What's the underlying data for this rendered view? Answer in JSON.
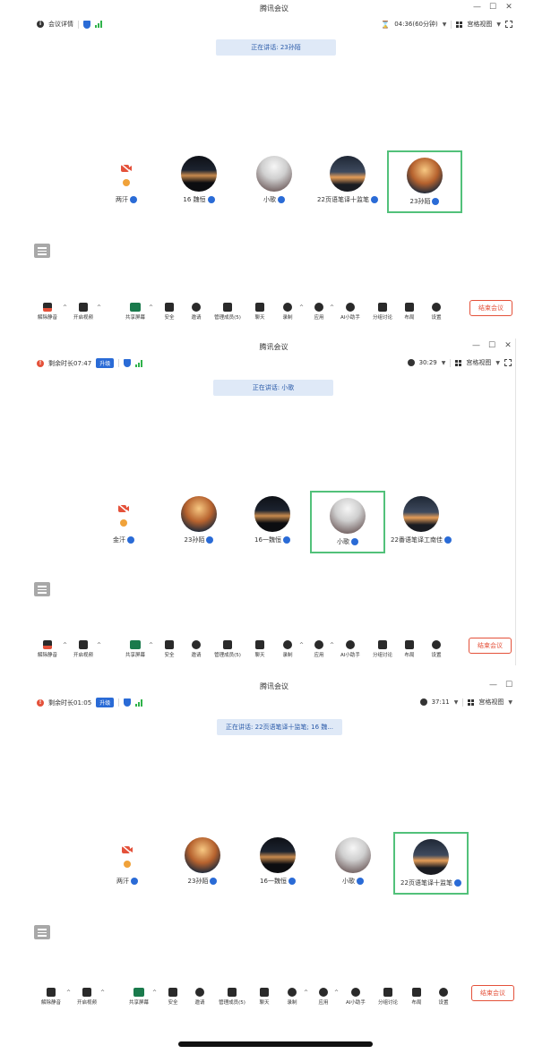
{
  "windows": [
    {
      "title": "腾讯会议",
      "status_left_text": "会议详情",
      "status_left_kind": "info",
      "upgrade_label": "",
      "timer": "04:36(60分钟)",
      "view_label": "宫格视图",
      "speaking": "正在讲话: 23孙陌",
      "participants": [
        {
          "name": "两汗",
          "avatar": "none",
          "active": false
        },
        {
          "name": "16  魏恒",
          "avatar": "e",
          "active": false
        },
        {
          "name": "小歌",
          "avatar": "c",
          "active": false
        },
        {
          "name": "22页语笔译十监笔",
          "avatar": "d",
          "active": false
        },
        {
          "name": "23孙陌",
          "avatar": "a",
          "active": true
        }
      ]
    },
    {
      "title": "腾讯会议",
      "status_left_text": "剩余时长07:47",
      "status_left_kind": "red",
      "upgrade_label": "升级",
      "timer": "30:29",
      "view_label": "宫格视图",
      "speaking": "正在讲话: 小歌",
      "participants": [
        {
          "name": "金汗",
          "avatar": "none",
          "active": false
        },
        {
          "name": "23孙陌",
          "avatar": "a",
          "active": false
        },
        {
          "name": "16一魏恒",
          "avatar": "e",
          "active": false
        },
        {
          "name": "小歌",
          "avatar": "c",
          "active": true
        },
        {
          "name": "22番语笔译工南佳",
          "avatar": "d",
          "active": false
        }
      ]
    },
    {
      "title": "腾讯会议",
      "status_left_text": "剩余时长01:05",
      "status_left_kind": "red",
      "upgrade_label": "升级",
      "timer": "37:11",
      "view_label": "宫格视图",
      "speaking": "正在讲话: 22页语笔译十监笔; 16 魏...",
      "participants": [
        {
          "name": "两汗",
          "avatar": "none",
          "active": false
        },
        {
          "name": "23孙陌",
          "avatar": "a",
          "active": false
        },
        {
          "name": "16一魏恒",
          "avatar": "e",
          "active": false
        },
        {
          "name": "小歌",
          "avatar": "c",
          "active": false
        },
        {
          "name": "22页语笔译十监笔",
          "avatar": "d",
          "active": true
        }
      ]
    }
  ],
  "toolbar": {
    "items": [
      "解除静音",
      "开启视频",
      "共享屏幕",
      "安全",
      "邀请",
      "管理成员(5)",
      "聊天",
      "录制",
      "应用",
      "AI小助手",
      "分组讨论",
      "布局",
      "设置"
    ],
    "end_label": "结束会议"
  },
  "colors": {
    "accent": "#2a6bd6",
    "active_border": "#52c17a",
    "end": "#e4513a",
    "speaking_bg": "#dfe9f7"
  },
  "icons": {
    "mic": "mic-off-icon",
    "video": "video-off-icon"
  }
}
